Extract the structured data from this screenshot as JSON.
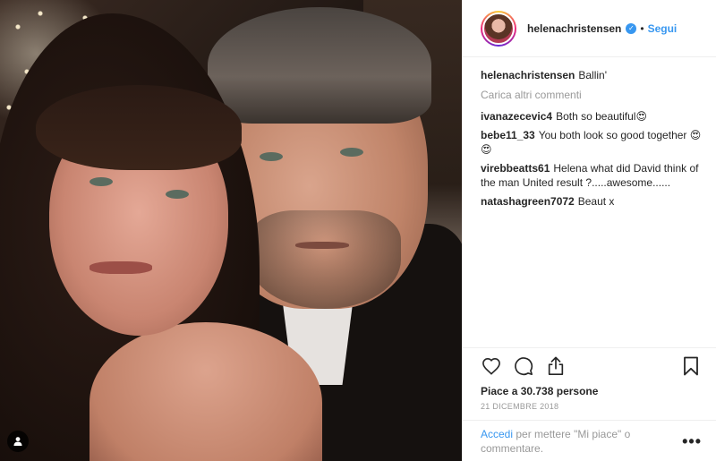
{
  "post": {
    "author": "helenachristensen",
    "follow_label": "Segui",
    "dot": "•",
    "verified_mark": "✓",
    "caption_author": "helenachristensen",
    "caption_text": "Ballin'",
    "load_more_label": "Carica altri commenti",
    "comments": [
      {
        "author": "ivanazecevic4",
        "text": "Both so beautiful😍"
      },
      {
        "author": "bebe11_33",
        "text": "You both look so good together 😍😍"
      },
      {
        "author": "virebbeatts61",
        "text": "Helena what did David think of the man United result ?.....awesome......"
      },
      {
        "author": "natashagreen7072",
        "text": "Beaut x"
      }
    ],
    "likes_label": "Piace a 30.738 persone",
    "date": "21 DICEMBRE 2018",
    "login_link": "Accedi",
    "login_rest": "per mettere \"Mi piace\" o commentare.",
    "more_label": "•••"
  },
  "icons": {
    "like": "heart-icon",
    "comment": "comment-bubble-icon",
    "share": "share-icon",
    "save": "bookmark-icon",
    "tag": "user-tag-icon"
  },
  "colors": {
    "accent": "#3897f0",
    "muted": "#999999",
    "text": "#262626",
    "border": "#efefef"
  }
}
